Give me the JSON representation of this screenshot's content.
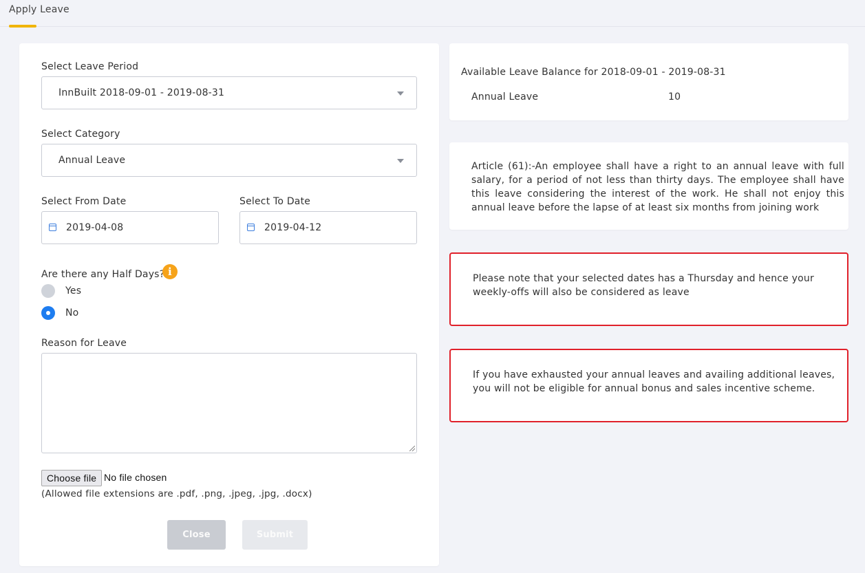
{
  "header": {
    "tab_label": "Apply Leave",
    "accent_color": "#f0b400"
  },
  "form": {
    "leave_period": {
      "label": "Select Leave Period",
      "value": "InnBuilt 2018-09-01 - 2019-08-31"
    },
    "category": {
      "label": "Select Category",
      "value": "Annual Leave"
    },
    "from_date": {
      "label": "Select From Date",
      "value": "2019-04-08"
    },
    "to_date": {
      "label": "Select To Date",
      "value": "2019-04-12"
    },
    "half_days": {
      "label": "Are there any Half Days?",
      "options": [
        {
          "label": "Yes",
          "selected": false
        },
        {
          "label": "No",
          "selected": true
        }
      ]
    },
    "reason": {
      "label": "Reason for Leave",
      "value": ""
    },
    "file": {
      "button_label": "Choose file",
      "status": "No file chosen",
      "hint": "(Allowed file extensions are .pdf, .png, .jpeg, .jpg, .docx)"
    },
    "buttons": {
      "close_label": "Close",
      "submit_label": "Submit"
    }
  },
  "balance": {
    "title": "Available Leave Balance for 2018-09-01 - 2019-08-31",
    "rows": [
      {
        "type": "Annual Leave",
        "value": "10"
      }
    ]
  },
  "article": {
    "text": "Article (61):-An employee shall have a right to an annual leave with full salary, for a period of not less than thirty days. The employee shall have this leave considering the interest of the work. He shall not enjoy this annual leave before the lapse of at least six months from joining work"
  },
  "notices": [
    {
      "text": "Please note that your selected dates has a Thursday and hence your weekly-offs will also be considered as leave"
    },
    {
      "text": "If you have exhausted your annual leaves and availing additional leaves, you will not be eligible for annual bonus and sales incentive scheme."
    }
  ],
  "colors": {
    "warning_border": "#e0202a",
    "radio_selected": "#1e7df0",
    "info_icon": "#f6a31a"
  }
}
